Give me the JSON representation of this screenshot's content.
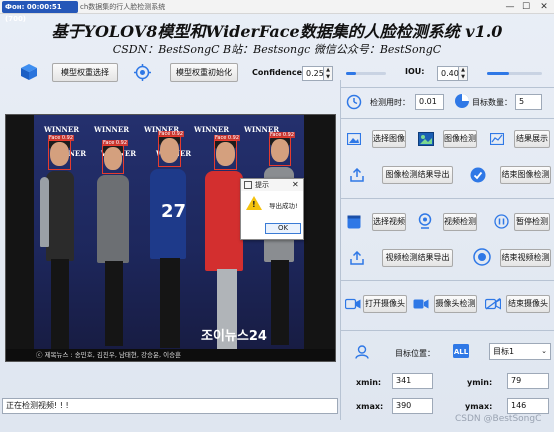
{
  "window": {
    "app_badge": "Фон: 00:00:51 (700)",
    "title": "ch数据集的行人脸检测系统",
    "minimize_label": "—",
    "maximize_label": "☐",
    "close_label": "✕"
  },
  "header": {
    "title": "基于YOLOV8模型和WiderFace数据集的人脸检测系统 v1.0",
    "subtitle": "CSDN：BestSongC   B站：Bestsongc   微信公众号：BestSongC"
  },
  "top_controls": {
    "select_weights_label": "模型权重选择",
    "init_weights_label": "模型权重初始化",
    "confidence_label": "Confidence:",
    "confidence_value": "0.25",
    "confidence_fraction": 0.25,
    "iou_label": "IOU:",
    "iou_value": "0.40",
    "iou_fraction": 0.4
  },
  "stats": {
    "time_label": "检测用时：",
    "time_value": "0.01",
    "count_label": "目标数量：",
    "count_value": "5"
  },
  "image_section": {
    "select_label": "选择图像",
    "detect_label": "图像检测",
    "show_label": "结果展示",
    "export_label": "图像检测结果导出",
    "finish_label": "结束图像检测"
  },
  "video_section": {
    "select_label": "选择视频",
    "detect_label": "视频检测",
    "pause_label": "暂停检测",
    "export_label": "视频检测结果导出",
    "finish_label": "结束视频检测"
  },
  "camera_section": {
    "open_label": "打开摄像头",
    "detect_label": "摄像头检测",
    "close_label": "结束摄像头"
  },
  "target": {
    "position_label": "目标位置：",
    "select_value": "目标1",
    "xmin_label": "xmin:",
    "xmin_value": "341",
    "ymin_label": "ymin:",
    "ymin_value": "79",
    "xmax_label": "xmax:",
    "xmax_value": "390",
    "ymax_label": "ymax:",
    "ymax_value": "146"
  },
  "photo": {
    "ad_text": "WINNER",
    "face_label": "Face 0.92",
    "jersey_number": "27",
    "logo_text": "조이뉴스24",
    "caption": "ⓒ 제목뉴스 : 송민호, 김진우, 남태현, 강승윤, 이승훈"
  },
  "dialog": {
    "title": "提示",
    "message": "导出成功!",
    "ok_label": "OK",
    "close_label": "✕"
  },
  "status": {
    "text": "正在检测视频! ! !"
  },
  "footer": {
    "watermark": "CSDN @BestSongC"
  },
  "colors": {
    "accent": "#2f78e6",
    "face_box": "#e63b2e"
  }
}
